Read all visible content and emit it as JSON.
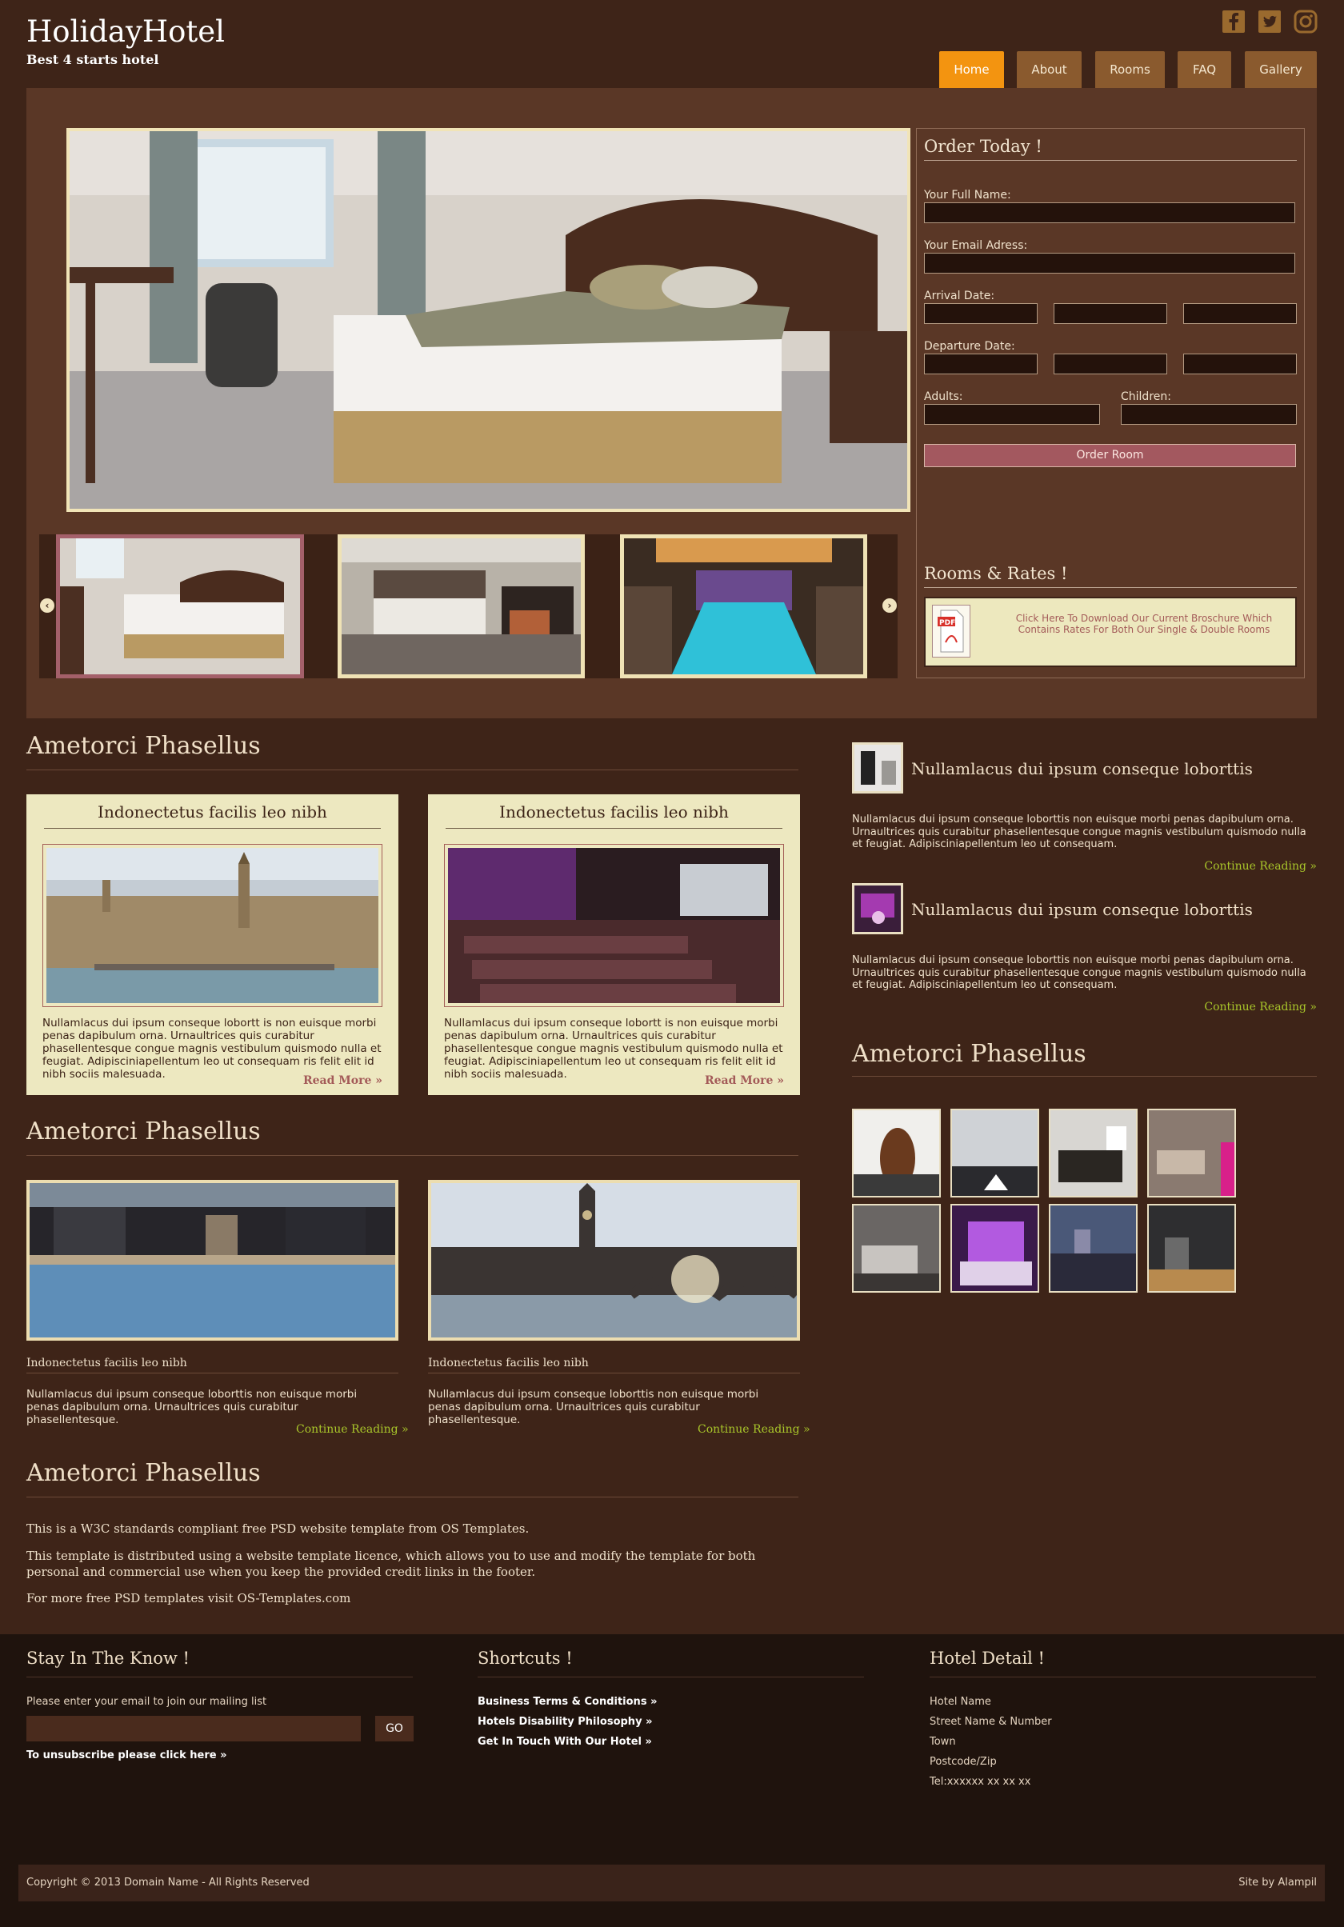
{
  "header": {
    "title": "HolidayHotel",
    "subtitle": "Best 4 starts hotel",
    "social": [
      "facebook-icon",
      "twitter-icon",
      "instagram-icon"
    ],
    "nav": [
      {
        "label": "Home",
        "active": true
      },
      {
        "label": "About"
      },
      {
        "label": "Rooms"
      },
      {
        "label": "FAQ"
      },
      {
        "label": "Gallery"
      }
    ]
  },
  "order": {
    "title": "Order Today !",
    "full_name_label": "Your Full Name:",
    "email_label": "Your Email Adress:",
    "arrival_label": "Arrival Date:",
    "departure_label": "Departure Date:",
    "adults_label": "Adults:",
    "children_label": "Children:",
    "button": "Order Room"
  },
  "rates": {
    "title": "Rooms & Rates !",
    "text": "Click Here To Download Our Current Broschure Which Contains Rates For Both Our Single & Double Rooms",
    "pdf_label": "PDF"
  },
  "section1": {
    "heading": "Ametorci Phasellus",
    "cards": [
      {
        "title": "Indonectetus facilis leo nibh",
        "text": "Nullamlacus dui ipsum conseque lobortt is non euisque morbi penas dapibulum orna. Urnaultrices quis curabitur phasellentesque congue magnis vestibulum quismodo nulla et feugiat. Adipisciniapellentum leo ut consequam ris felit elit id nibh sociis malesuada.",
        "more": "Read More »"
      },
      {
        "title": "Indonectetus facilis leo nibh",
        "text": "Nullamlacus dui ipsum conseque lobortt is non euisque morbi penas dapibulum orna. Urnaultrices quis curabitur phasellentesque congue magnis vestibulum quismodo nulla et feugiat. Adipisciniapellentum leo ut consequam ris felit elit id nibh sociis malesuada.",
        "more": "Read More »"
      }
    ]
  },
  "section2": {
    "heading": "Ametorci Phasellus",
    "posts": [
      {
        "title": "Indonectetus facilis leo nibh",
        "text": "Nullamlacus dui ipsum conseque loborttis non euisque morbi penas dapibulum orna. Urnaultrices quis curabitur phasellentesque.",
        "more": "Continue Reading »"
      },
      {
        "title": "Indonectetus facilis leo nibh",
        "text": "Nullamlacus dui ipsum conseque loborttis non euisque morbi penas dapibulum orna. Urnaultrices quis curabitur phasellentesque.",
        "more": "Continue Reading »"
      }
    ]
  },
  "section3": {
    "heading": "Ametorci Phasellus",
    "p1": "This is a W3C standards compliant free PSD website template from OS Templates.",
    "p2": "This template is distributed using a website template licence, which allows you to use and modify the template for both personal and commercial use when you keep the provided credit links in the footer.",
    "p3": "For more free PSD templates visit OS-Templates.com"
  },
  "sidebar": {
    "items": [
      {
        "title": "Nullamlacus dui ipsum conseque loborttis",
        "text": "Nullamlacus dui ipsum conseque loborttis non euisque morbi penas dapibulum orna. Urnaultrices quis curabitur phasellentesque congue magnis vestibulum quismodo nulla et feugiat. Adipisciniapellentum leo ut consequam.",
        "more": "Continue Reading »"
      },
      {
        "title": "Nullamlacus dui ipsum conseque loborttis",
        "text": "Nullamlacus dui ipsum conseque loborttis non euisque morbi penas dapibulum orna. Urnaultrices quis curabitur phasellentesque congue magnis vestibulum quismodo nulla et feugiat. Adipisciniapellentum leo ut consequam.",
        "more": "Continue Reading »"
      }
    ],
    "gallery_heading": "Ametorci Phasellus"
  },
  "footer": {
    "newsletter": {
      "title": "Stay In The Know !",
      "prompt": "Please enter your email to join our mailing list",
      "button": "GO",
      "unsubscribe": "To unsubscribe please click here »"
    },
    "shortcuts": {
      "title": "Shortcuts !",
      "links": [
        "Business Terms & Conditions »",
        "Hotels Disability Philosophy »",
        "Get In Touch With Our Hotel »"
      ]
    },
    "detail": {
      "title": "Hotel Detail !",
      "lines": [
        "Hotel Name",
        "Street Name & Number",
        "Town",
        "Postcode/Zip",
        "Tel:xxxxxx xx xx xx"
      ]
    },
    "copyright": "Copyright © 2013 Domain Name - All Rights Reserved",
    "credit": "Site by Alampil"
  },
  "colors": {
    "background": "#3e2418",
    "panel": "#5a3726",
    "accent_orange": "#f39410",
    "nav_brown": "#8a5a2e",
    "card_cream": "#ede8c0",
    "link_green": "#a9c62a",
    "rose": "#a3585f"
  }
}
